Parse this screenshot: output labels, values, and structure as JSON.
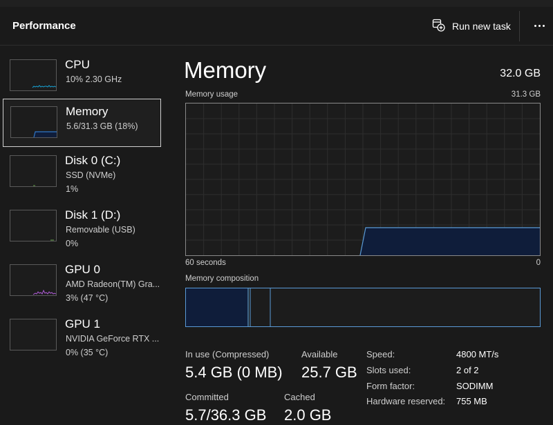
{
  "header": {
    "title": "Performance",
    "run_new_task_label": "Run new task"
  },
  "sidebar": {
    "items": [
      {
        "name": "CPU",
        "sub1": "10%  2.30 GHz",
        "sub2": "",
        "selected": false,
        "graph_color": "#17a3d6"
      },
      {
        "name": "Memory",
        "sub1": "5.6/31.3 GB (18%)",
        "sub2": "",
        "selected": true,
        "graph_color": "#2f77c8"
      },
      {
        "name": "Disk 0 (C:)",
        "sub1": "SSD (NVMe)",
        "sub2": "1%",
        "selected": false,
        "graph_color": "#6aa84f"
      },
      {
        "name": "Disk 1 (D:)",
        "sub1": "Removable (USB)",
        "sub2": "0%",
        "selected": false,
        "graph_color": "#6aa84f"
      },
      {
        "name": "GPU 0",
        "sub1": "AMD Radeon(TM) Gra...",
        "sub2": "3%  (47 °C)",
        "selected": false,
        "graph_color": "#b05cd8"
      },
      {
        "name": "GPU 1",
        "sub1": "NVIDIA GeForce RTX ...",
        "sub2": "0%  (35 °C)",
        "selected": false,
        "graph_color": "#b05cd8"
      }
    ]
  },
  "main": {
    "title": "Memory",
    "total": "32.0 GB",
    "usage_label": "Memory usage",
    "usage_max": "31.3 GB",
    "axis_left": "60 seconds",
    "axis_right": "0",
    "composition_label": "Memory composition",
    "stats": {
      "in_use_label": "In use (Compressed)",
      "in_use_value": "5.4 GB (0 MB)",
      "available_label": "Available",
      "available_value": "25.7 GB",
      "committed_label": "Committed",
      "committed_value": "5.7/36.3 GB",
      "cached_label": "Cached",
      "cached_value": "2.0 GB"
    },
    "details": [
      {
        "key": "Speed:",
        "value": "4800 MT/s"
      },
      {
        "key": "Slots used:",
        "value": "2 of 2"
      },
      {
        "key": "Form factor:",
        "value": "SODIMM"
      },
      {
        "key": "Hardware reserved:",
        "value": "755 MB"
      }
    ]
  },
  "colors": {
    "accent_line": "#5a9bd8",
    "fill": "#0f1d3a"
  }
}
